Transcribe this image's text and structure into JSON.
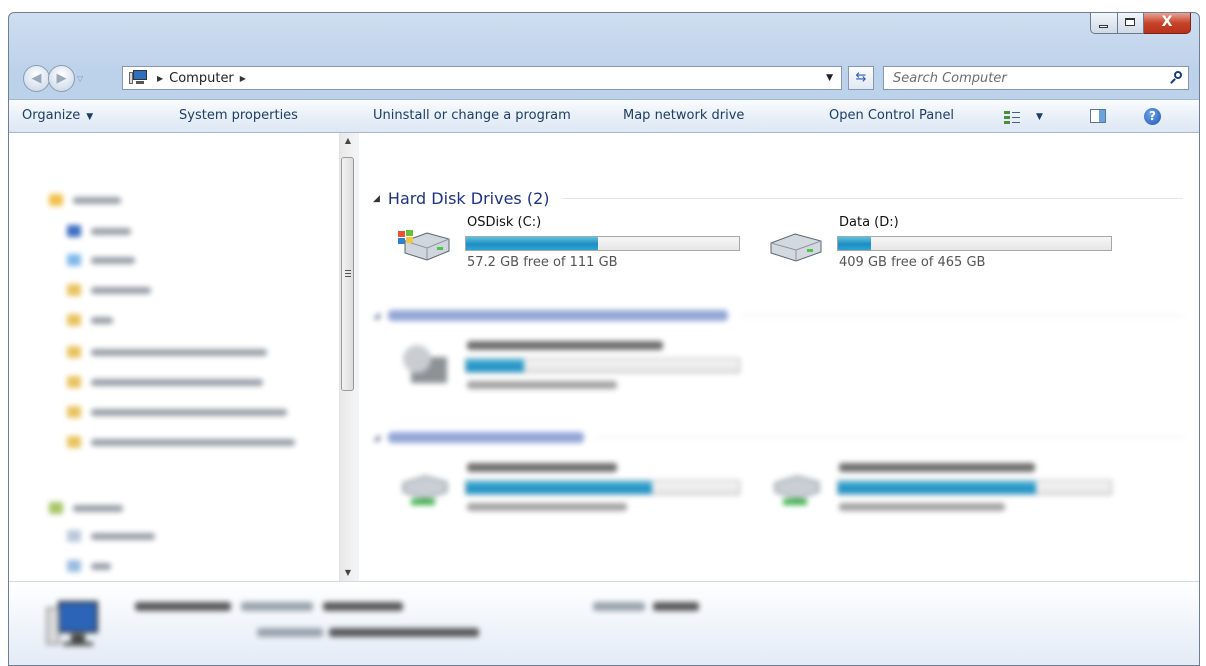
{
  "window": {
    "caption": {
      "close_glyph": "X"
    }
  },
  "address_bar": {
    "crumbs": [
      "Computer"
    ],
    "search_placeholder": "Search Computer"
  },
  "command_bar": {
    "organize": "Organize",
    "system_properties": "System properties",
    "uninstall": "Uninstall or change a program",
    "map_drive": "Map network drive",
    "control_panel": "Open Control Panel",
    "help_glyph": "?"
  },
  "content": {
    "hard_disk_group": {
      "label": "Hard Disk Drives (2)",
      "drives": [
        {
          "name": "OSDisk (C:)",
          "free_text": "57.2 GB free of 111 GB",
          "used_fraction": 0.485
        },
        {
          "name": "Data (D:)",
          "free_text": "409 GB free of 465 GB",
          "used_fraction": 0.12
        }
      ]
    }
  },
  "colors": {
    "group_header": "#1e3287",
    "usage_bar": "#1f8cc2",
    "window_frame": "#bcd1ea",
    "close_button": "#c7432a"
  },
  "icons": {
    "back": "back-arrow-icon",
    "forward": "forward-arrow-icon",
    "computer": "computer-icon",
    "refresh": "refresh-icon",
    "search": "search-icon",
    "drive": "hard-drive-icon",
    "help": "help-icon"
  }
}
